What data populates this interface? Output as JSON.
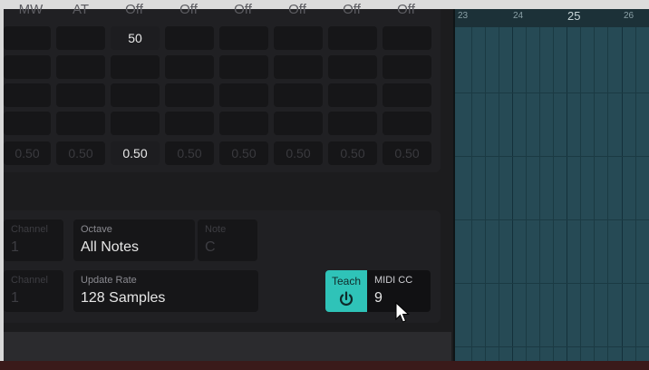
{
  "grid": {
    "columns": [
      "MW",
      "AT",
      "Off",
      "Off",
      "Off",
      "Off",
      "Off",
      "Off"
    ],
    "row1": [
      "",
      "",
      "50",
      "",
      "",
      "",
      "",
      ""
    ],
    "row5": [
      "0.50",
      "0.50",
      "0.50",
      "0.50",
      "0.50",
      "0.50",
      "0.50",
      "0.50"
    ]
  },
  "settings": {
    "row1": {
      "channel_label": "Channel",
      "channel_value": "1",
      "octave_label": "Octave",
      "octave_value": "All Notes",
      "note_label": "Note",
      "note_value": "C"
    },
    "row2": {
      "channel_label": "Channel",
      "channel_value": "1",
      "update_rate_label": "Update Rate",
      "update_rate_value": "128 Samples"
    },
    "teach_label": "Teach",
    "midi_cc_label": "MIDI CC",
    "midi_cc_value": "9"
  },
  "timeline": {
    "markers": [
      "23",
      "24",
      "25",
      "26"
    ],
    "accent": "#2fc3b8"
  }
}
